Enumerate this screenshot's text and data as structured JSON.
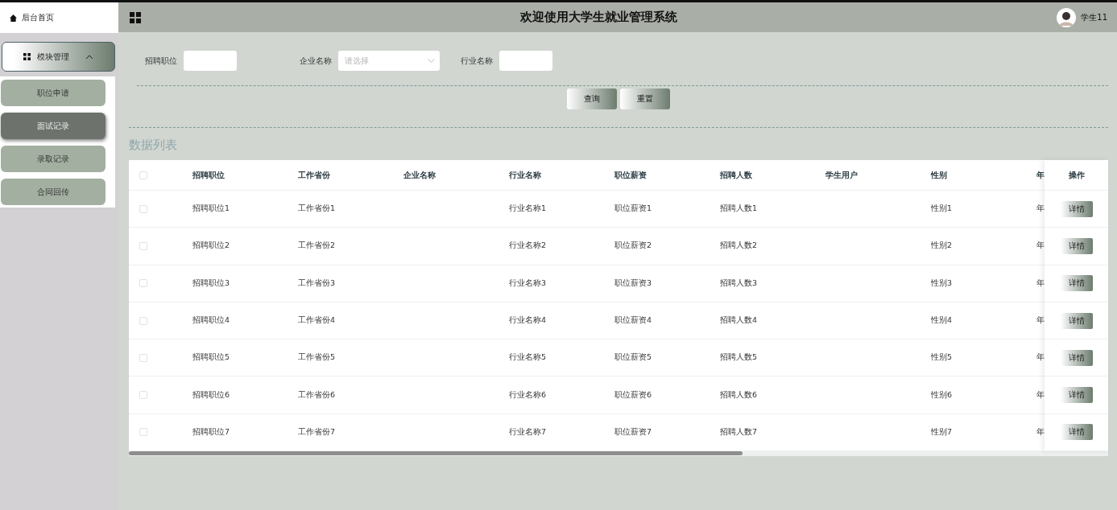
{
  "header": {
    "title": "欢迎使用大学生就业管理系统",
    "user": "学生11"
  },
  "sidebar": {
    "home": "后台首页",
    "menu": {
      "label": "模块管理",
      "expanded": true,
      "items": [
        {
          "label": "职位申请",
          "selected": false
        },
        {
          "label": "面试记录",
          "selected": true
        },
        {
          "label": "录取记录",
          "selected": false
        },
        {
          "label": "合同回传",
          "selected": false
        }
      ]
    }
  },
  "filters": [
    {
      "label": "招聘职位",
      "kind": "input"
    },
    {
      "label": "企业名称",
      "kind": "select",
      "placeholder": "请选择"
    },
    {
      "label": "行业名称",
      "kind": "input"
    }
  ],
  "buttons": [
    "查询",
    "重置"
  ],
  "section_title": "数据列表",
  "table": {
    "select_all": false,
    "columns": [
      "招聘职位",
      "工作省份",
      "企业名称",
      "行业名称",
      "职位薪资",
      "招聘人数",
      "学生用户",
      "性别",
      "年"
    ],
    "action_column": "操作",
    "rows": [
      {
        "checked": false,
        "cells": [
          "招聘职位1",
          "工作省份1",
          "",
          "行业名称1",
          "职位薪资1",
          "招聘人数1",
          "",
          "性别1",
          "年"
        ],
        "action": "详情"
      },
      {
        "checked": false,
        "cells": [
          "招聘职位2",
          "工作省份2",
          "",
          "行业名称2",
          "职位薪资2",
          "招聘人数2",
          "",
          "性别2",
          "年"
        ],
        "action": "详情"
      },
      {
        "checked": false,
        "cells": [
          "招聘职位3",
          "工作省份3",
          "",
          "行业名称3",
          "职位薪资3",
          "招聘人数3",
          "",
          "性别3",
          "年"
        ],
        "action": "详情"
      },
      {
        "checked": false,
        "cells": [
          "招聘职位4",
          "工作省份4",
          "",
          "行业名称4",
          "职位薪资4",
          "招聘人数4",
          "",
          "性别4",
          "年"
        ],
        "action": "详情"
      },
      {
        "checked": false,
        "cells": [
          "招聘职位5",
          "工作省份5",
          "",
          "行业名称5",
          "职位薪资5",
          "招聘人数5",
          "",
          "性别5",
          "年"
        ],
        "action": "详情"
      },
      {
        "checked": false,
        "cells": [
          "招聘职位6",
          "工作省份6",
          "",
          "行业名称6",
          "职位薪资6",
          "招聘人数6",
          "",
          "性别6",
          "年"
        ],
        "action": "详情"
      },
      {
        "checked": false,
        "cells": [
          "招聘职位7",
          "工作省份7",
          "",
          "行业名称7",
          "职位薪资7",
          "招聘人数7",
          "",
          "性别7",
          "年"
        ],
        "action": "详情"
      }
    ]
  }
}
